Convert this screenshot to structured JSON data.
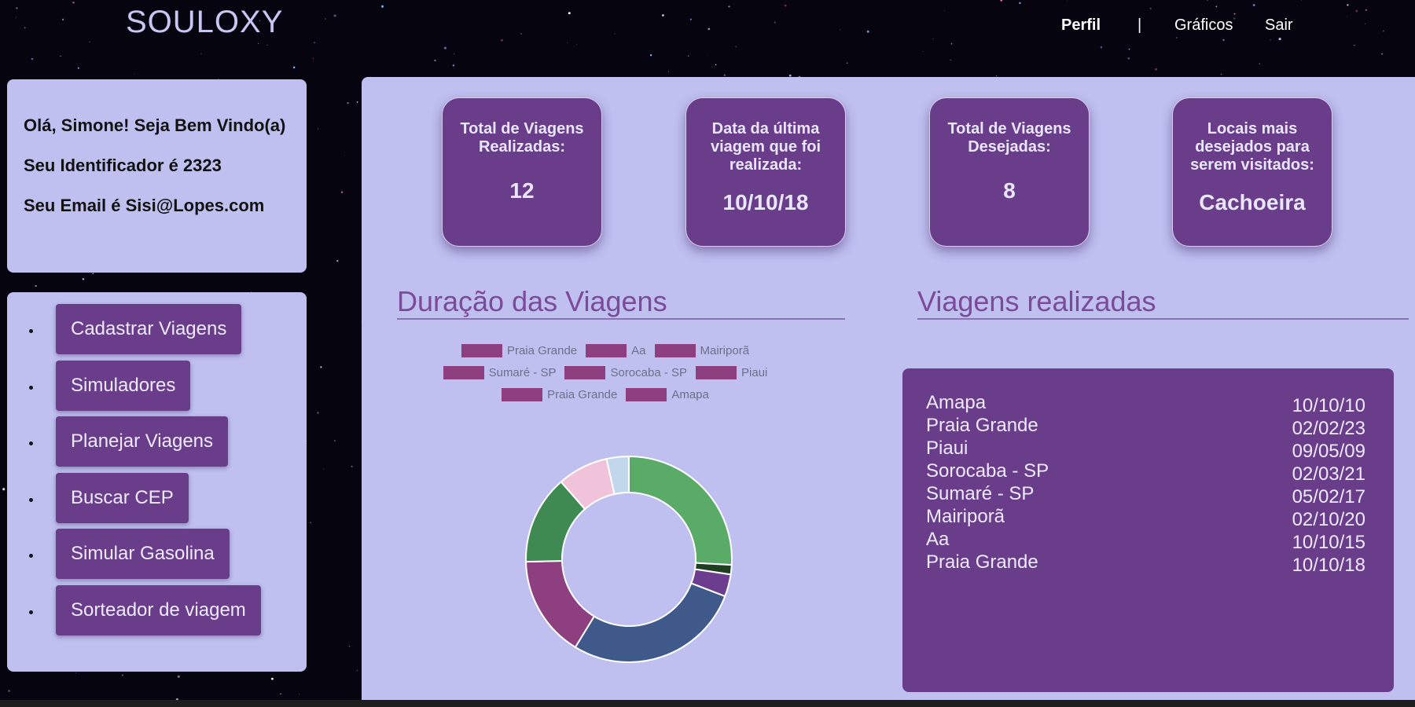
{
  "header": {
    "brand": "SOULOXY",
    "nav": {
      "perfil": "Perfil",
      "separator": "|",
      "graficos": "Gráficos",
      "sair": "Sair"
    }
  },
  "welcome": {
    "greeting": "Olá, Simone! Seja Bem Vindo(a)",
    "identifier": "Seu Identificador é 2323",
    "email": "Seu Email é Sisi@Lopes.com"
  },
  "menu": {
    "items": [
      {
        "label": "Cadastrar Viagens"
      },
      {
        "label": "Simuladores"
      },
      {
        "label": "Planejar Viagens"
      },
      {
        "label": "Buscar CEP"
      },
      {
        "label": "Simular Gasolina"
      },
      {
        "label": "Sorteador de viagem"
      }
    ]
  },
  "stats": [
    {
      "label": "Total de Viagens Realizadas:",
      "value": "12"
    },
    {
      "label": "Data da última viagem que foi realizada:",
      "value": "10/10/18"
    },
    {
      "label": "Total de Viagens Desejadas:",
      "value": "8"
    },
    {
      "label": "Locais mais desejados para serem visitados:",
      "value": "Cachoeira"
    }
  ],
  "duration_section": {
    "title": "Duração das Viagens"
  },
  "trips_section": {
    "title": "Viagens realizadas"
  },
  "legend": {
    "rows": [
      [
        "Praia Grande",
        "Aa",
        "Mairiporã"
      ],
      [
        "Sumaré - SP",
        "Sorocaba - SP",
        "Piaui"
      ],
      [
        "Praia Grande",
        "Amapa"
      ]
    ],
    "swatch_color": "#8d3f80"
  },
  "chart_data": {
    "type": "pie",
    "title": "",
    "series": [
      {
        "name": "",
        "value": 26,
        "color": "#5aaa68"
      },
      {
        "name": "",
        "value": 1.5,
        "color": "#1f3f22"
      },
      {
        "name": "",
        "value": 3.5,
        "color": "#6c3c8f"
      },
      {
        "name": "",
        "value": 28,
        "color": "#3f5a8a"
      },
      {
        "name": "",
        "value": 16,
        "color": "#8d3f80"
      },
      {
        "name": "",
        "value": 14,
        "color": "#3f8a52"
      },
      {
        "name": "",
        "value": 8,
        "color": "#f0c3db"
      },
      {
        "name": "",
        "value": 3.5,
        "color": "#c3d7ec"
      }
    ]
  },
  "trips": [
    {
      "place": "Amapa",
      "date": "10/10/10"
    },
    {
      "place": "Praia Grande",
      "date": "02/02/23"
    },
    {
      "place": "Piaui",
      "date": "09/05/09"
    },
    {
      "place": "Sorocaba - SP",
      "date": "02/03/21"
    },
    {
      "place": "Sumaré - SP",
      "date": "05/02/17"
    },
    {
      "place": "Mairiporã",
      "date": "02/10/20"
    },
    {
      "place": "Aa",
      "date": "10/10/15"
    },
    {
      "place": "Praia Grande",
      "date": "10/10/18"
    }
  ],
  "colors": {
    "accent": "#6a3d8a",
    "panel": "#bfc0f0",
    "title": "#7b4a99"
  }
}
